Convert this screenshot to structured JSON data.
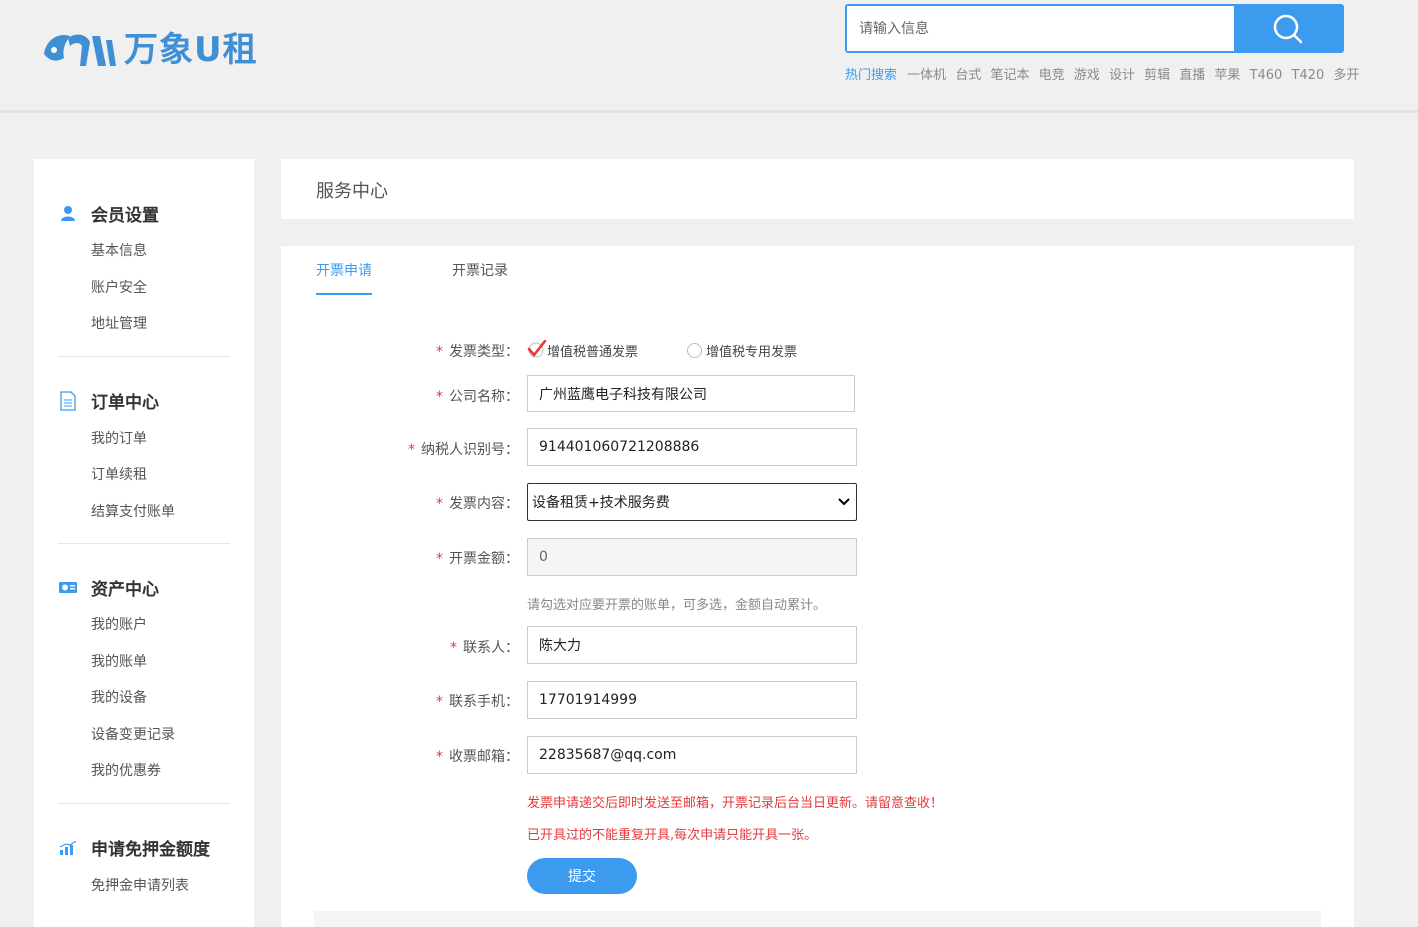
{
  "brand": {
    "name": "万象U租",
    "color": "#3f8fd4"
  },
  "search": {
    "placeholder": "请输入信息",
    "icon": "search-icon"
  },
  "hot_search": {
    "label": "热门搜索",
    "keywords": [
      "一体机",
      "台式",
      "笔记本",
      "电竞",
      "游戏",
      "设计",
      "剪辑",
      "直播",
      "苹果",
      "T460",
      "T420",
      "多开"
    ]
  },
  "sidebar": {
    "groups": [
      {
        "title": "会员设置",
        "icon": "user-icon",
        "items": [
          "基本信息",
          "账户安全",
          "地址管理"
        ]
      },
      {
        "title": "订单中心",
        "icon": "document-icon",
        "items": [
          "我的订单",
          "订单续租",
          "结算支付账单"
        ]
      },
      {
        "title": "资产中心",
        "icon": "money-icon",
        "items": [
          "我的账户",
          "我的账单",
          "我的设备",
          "设备变更记录",
          "我的优惠券"
        ]
      },
      {
        "title": "申请免押金额度",
        "icon": "chart-icon",
        "items": [
          "免押金申请列表"
        ]
      }
    ]
  },
  "main": {
    "title": "服务中心",
    "tabs": [
      {
        "label": "开票申请",
        "active": true
      },
      {
        "label": "开票记录",
        "active": false
      }
    ],
    "form": {
      "invoice_type": {
        "label": "发票类型：",
        "options": [
          "增值税普通发票",
          "增值税专用发票"
        ],
        "selected": "增值税普通发票"
      },
      "company": {
        "label": "公司名称：",
        "value": "广州蓝鹰电子科技有限公司"
      },
      "tax_id": {
        "label": "纳税人识别号：",
        "value": "914401060721208886"
      },
      "content": {
        "label": "发票内容：",
        "value": "设备租赁+技术服务费"
      },
      "amount": {
        "label": "开票金额：",
        "value": "0",
        "hint": "请勾选对应要开票的账单，可多选，金额自动累计。"
      },
      "contact": {
        "label": "联系人：",
        "value": "陈大力"
      },
      "phone": {
        "label": "联系手机：",
        "value": "17701914999"
      },
      "email": {
        "label": "收票邮箱：",
        "value": "22835687@qq.com"
      },
      "notice1": "发票申请递交后即时发送至邮箱，开票记录后台当日更新。请留意查收！",
      "notice2": "已开具过的不能重复开具,每次申请只能开具一张。",
      "submit_label": "提交"
    }
  },
  "colors": {
    "accent": "#3d9bef",
    "required": "#e4393c",
    "check": "#e4393c"
  }
}
